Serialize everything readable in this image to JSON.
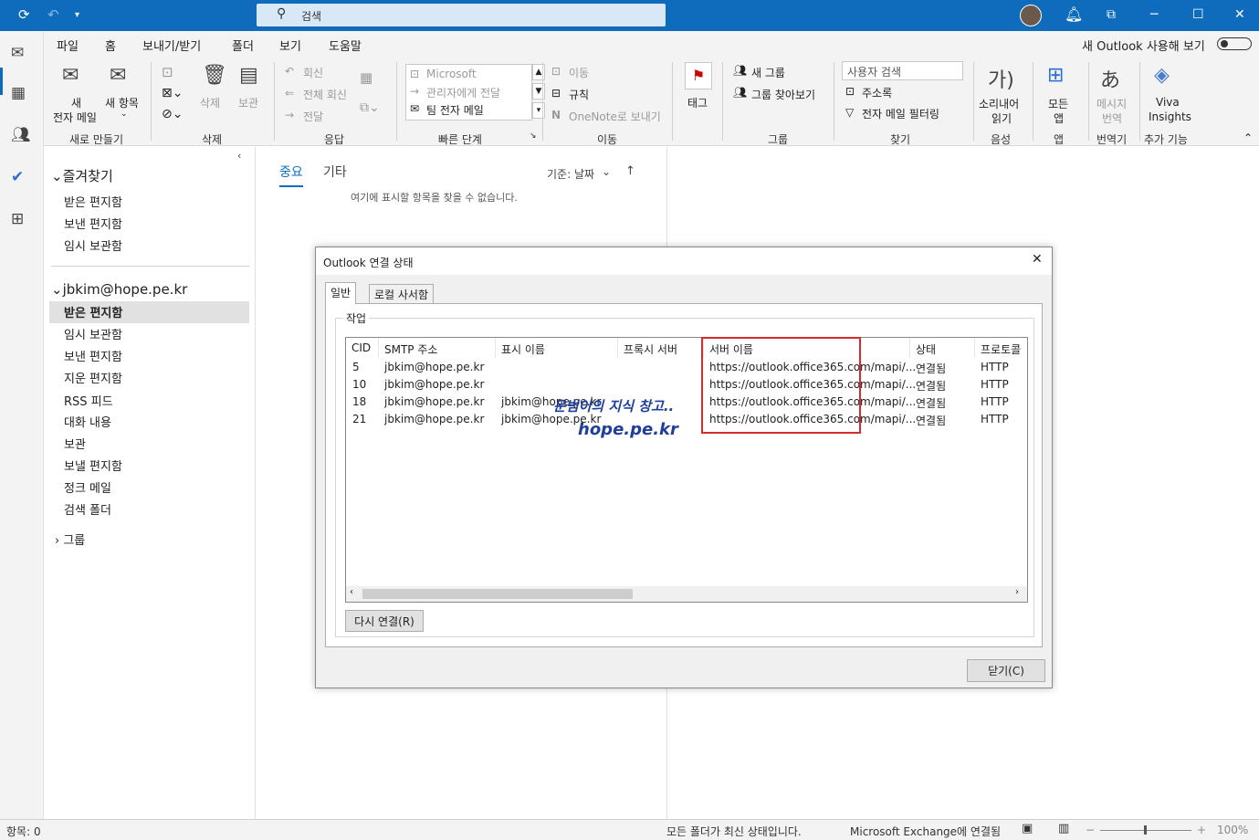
{
  "title_bar": {
    "search_label": "검색",
    "sync_icon": "sync-icon",
    "undo_icon": "undo-icon",
    "dropdown_icon": "chevron-down-icon"
  },
  "menu": {
    "items": [
      "파일",
      "홈",
      "보내기/받기",
      "폴더",
      "보기",
      "도움말"
    ],
    "selected": "홈",
    "new_outlook_label": "새 Outlook 사용해 보기"
  },
  "ribbon": {
    "new_mail": [
      "새",
      "전자 메일"
    ],
    "new_items": "새 항목",
    "group_new": "새로 만들기",
    "delete": "삭제",
    "archive": "보관",
    "group_delete": "삭제",
    "reply": "회신",
    "reply_all": "전체 회신",
    "forward": "전달",
    "group_respond": "응답",
    "qs_items": [
      "Microsoft",
      "관리자에게 전달",
      "팀 전자 메일"
    ],
    "group_quicksteps": "빠른 단계",
    "move": "이동",
    "rules": "규칙",
    "onenote": "OneNote로 보내기",
    "group_move": "이동",
    "tags": "태그",
    "new_group": "새 그룹",
    "browse_groups": "그룹 찾아보기",
    "group_groups": "그룹",
    "find_user_placeholder": "사용자 검색",
    "address_book": "주소록",
    "filter_mail": "전자 메일 필터링",
    "group_find": "찾기",
    "read_aloud": [
      "소리내어",
      "읽기"
    ],
    "group_speech": "음성",
    "all_apps": [
      "모든",
      "앱"
    ],
    "group_apps": "앱",
    "translate": [
      "메시지",
      "번역"
    ],
    "group_translate": "번역기",
    "viva": [
      "Viva",
      "Insights"
    ],
    "group_addins": "추가 기능"
  },
  "folders": {
    "favorites_header": "즐겨찾기",
    "favorites": [
      "받은 편지함",
      "보낸 편지함",
      "임시 보관함"
    ],
    "account_header": "jbkim@hope.pe.kr",
    "account_folders": [
      "받은 편지함",
      "임시 보관함",
      "보낸 편지함",
      "지운 편지함",
      "RSS 피드",
      "대화 내용",
      "보관",
      "보낼 편지함",
      "정크 메일",
      "검색 폴더"
    ],
    "groups_header": "그룹"
  },
  "list": {
    "tab_focused": "중요",
    "tab_other": "기타",
    "sort_label": "기준: 날짜",
    "empty_message": "여기에 표시할 항목을 찾을 수 없습니다."
  },
  "dialog": {
    "title": "Outlook 연결 상태",
    "tabs": [
      "일반",
      "로컬 사서함"
    ],
    "group_label": "작업",
    "columns": [
      "CID",
      "SMTP 주소",
      "표시 이름",
      "프록시 서버",
      "서버 이름",
      "상태",
      "프로토콜"
    ],
    "rows": [
      {
        "cid": "5",
        "smtp": "jbkim@hope.pe.kr",
        "display": "",
        "proxy": "",
        "server": "https://outlook.office365.com/mapi/...",
        "status": "연결됨",
        "protocol": "HTTP"
      },
      {
        "cid": "10",
        "smtp": "jbkim@hope.pe.kr",
        "display": "",
        "proxy": "",
        "server": "https://outlook.office365.com/mapi/...",
        "status": "연결됨",
        "protocol": "HTTP"
      },
      {
        "cid": "18",
        "smtp": "jbkim@hope.pe.kr",
        "display": "jbkim@hope.pe.kr",
        "proxy": "",
        "server": "https://outlook.office365.com/mapi/...",
        "status": "연결됨",
        "protocol": "HTTP"
      },
      {
        "cid": "21",
        "smtp": "jbkim@hope.pe.kr",
        "display": "jbkim@hope.pe.kr",
        "proxy": "",
        "server": "https://outlook.office365.com/mapi/...",
        "status": "연결됨",
        "protocol": "HTTP"
      }
    ],
    "reconnect_button": "다시 연결(R)",
    "close_button": "닫기(C)",
    "highlight_color": "#d62c2c"
  },
  "watermark": {
    "line1": "운범이의 지식 창고..",
    "line2": "hope.pe.kr"
  },
  "status_bar": {
    "items_count": "항목: 0",
    "folder_status": "모든 폴더가 최신 상태입니다.",
    "connection": "Microsoft Exchange에 연결됨",
    "zoom": "100%"
  },
  "colors": {
    "accent": "#0f6cbd"
  }
}
